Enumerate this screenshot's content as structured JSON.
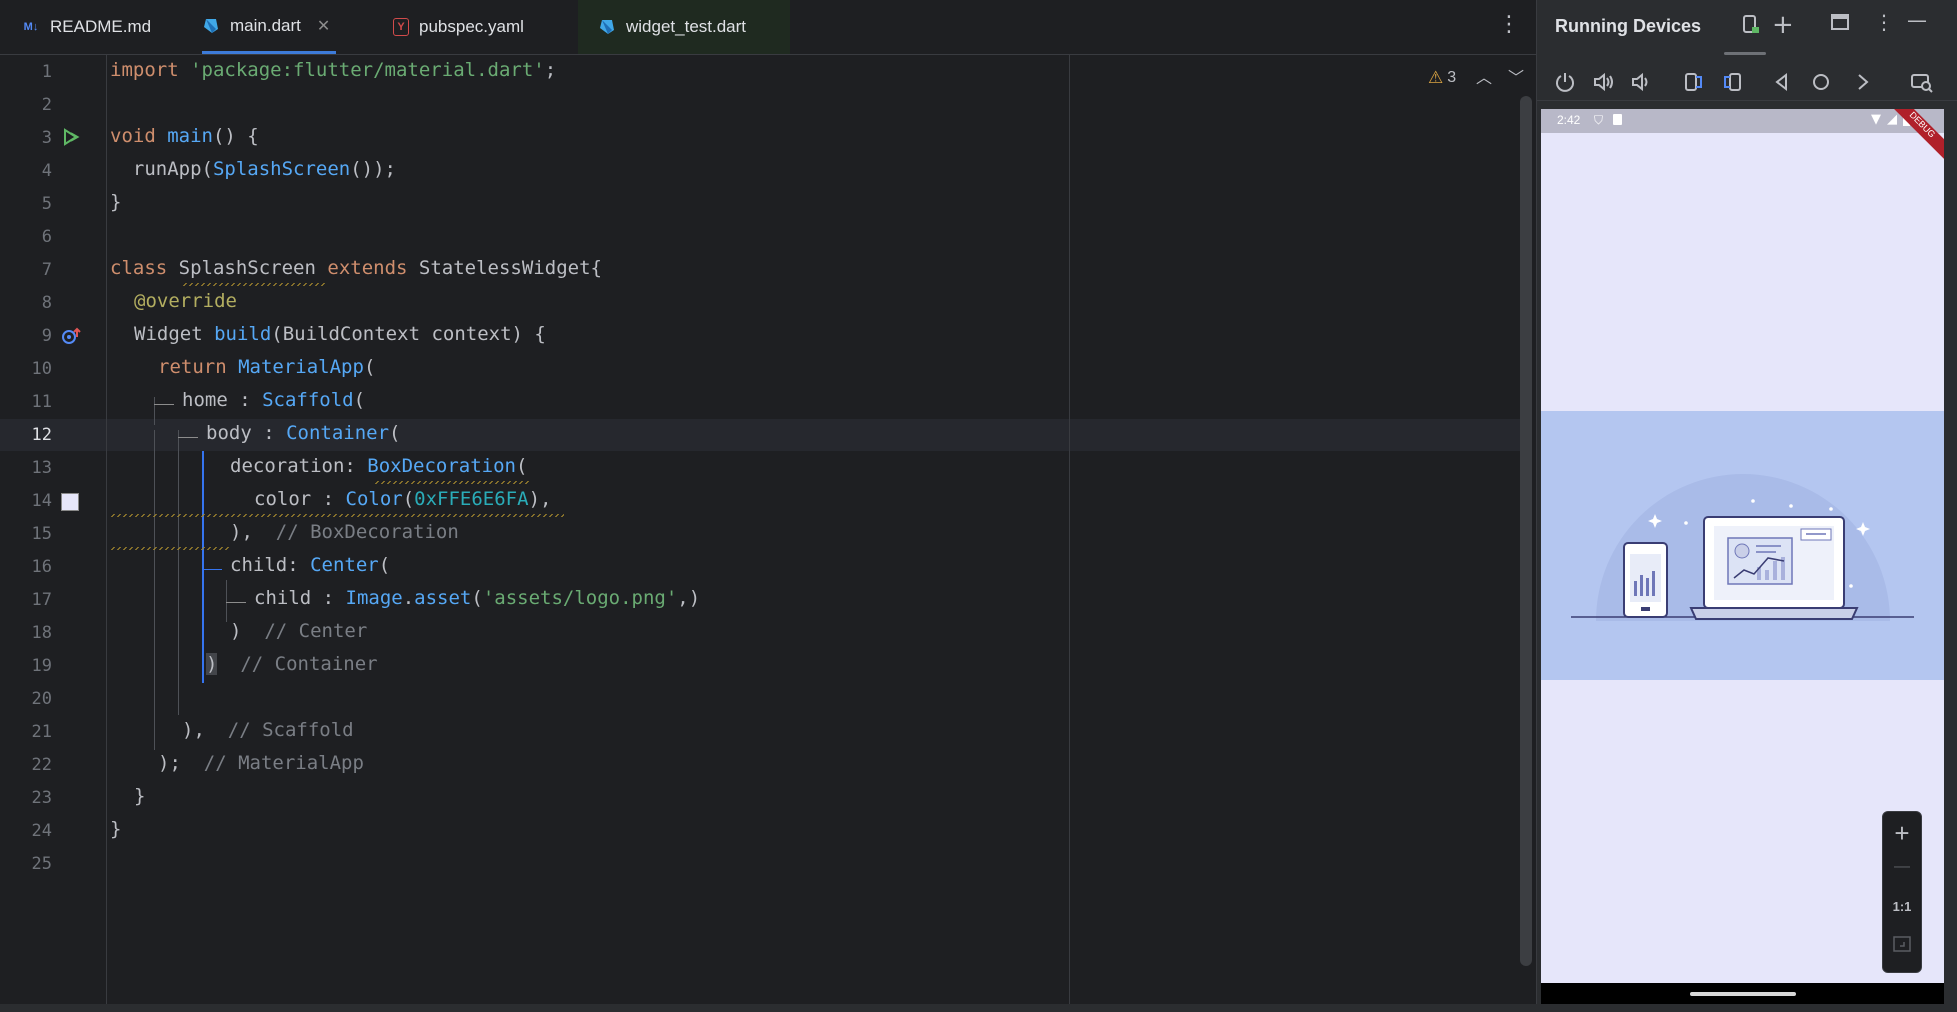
{
  "tabs": [
    {
      "label": "README.md",
      "icon": "markdown-icon",
      "active": false
    },
    {
      "label": "main.dart",
      "icon": "dart-icon",
      "active": true,
      "closable": true
    },
    {
      "label": "pubspec.yaml",
      "icon": "yaml-icon",
      "active": false
    },
    {
      "label": "widget_test.dart",
      "icon": "dart-icon",
      "active": false
    }
  ],
  "tab_close": "✕",
  "tab_icons": {
    "markdown": "M↓",
    "yaml": "Y"
  },
  "editor": {
    "current_line": 12,
    "warnings_count": "3",
    "line_numbers": [
      "1",
      "2",
      "3",
      "4",
      "5",
      "6",
      "7",
      "8",
      "9",
      "10",
      "11",
      "12",
      "13",
      "14",
      "15",
      "16",
      "17",
      "18",
      "19",
      "20",
      "21",
      "22",
      "23",
      "24",
      "25"
    ],
    "lines": {
      "l1_kw": "import",
      "l1_str": "'package:flutter/material.dart'",
      "l1_end": ";",
      "l3_kw": "void",
      "l3_fn": "main",
      "l3_end": "() {",
      "l4_a": "  runApp(",
      "l4_ty": "SplashScreen",
      "l4_end": "());",
      "l5": "}",
      "l7_kw": "class",
      "l7_name": "SplashScreen",
      "l7_kw2": "extends",
      "l7_end": "StatelessWidget{",
      "l8": "@override",
      "l9_a": "Widget",
      "l9_fn": "build",
      "l9_end": "(BuildContext context) {",
      "l10_kw": "return",
      "l10_ty": "MaterialApp",
      "l10_end": "(",
      "l11_a": "home : ",
      "l11_ty": "Scaffold",
      "l11_end": "(",
      "l12_a": "body : ",
      "l12_ty": "Container",
      "l12_end": "(",
      "l13_a": "decoration: ",
      "l13_ty": "BoxDecoration",
      "l13_end": "(",
      "l14_a": "color : ",
      "l14_ty": "Color",
      "l14_p": "(",
      "l14_num": "0xFFE6E6FA",
      "l14_end": "),",
      "l15_a": "),",
      "l15_cm": "// BoxDecoration",
      "l16_a": "child: ",
      "l16_ty": "Center",
      "l16_end": "(",
      "l17_a": "child : ",
      "l17_ty": "Image",
      "l17_dot": ".",
      "l17_fn": "asset",
      "l17_p": "(",
      "l17_str": "'assets/logo.png'",
      "l17_end": ",)",
      "l18_a": ")",
      "l18_cm": "// Center",
      "l19_a": ")",
      "l19_cm": "// Container",
      "l21_a": "),",
      "l21_cm": "// Scaffold",
      "l22_a": ");",
      "l22_cm": "// MaterialApp",
      "l23": "}",
      "l24": "}"
    },
    "color_swatch": "#E6E6FA"
  },
  "running_devices": {
    "title": "Running Devices",
    "toolbar_icons": [
      "power-icon",
      "volume-up-icon",
      "volume-down-icon",
      "rotate-left-icon",
      "rotate-right-icon",
      "back-icon",
      "home-icon",
      "overview-icon",
      "screenshot-icon"
    ],
    "phone": {
      "time": "2:42",
      "debug_label": "DEBUG",
      "background": "#E6E6FA",
      "band_color": "#B4C6F0"
    },
    "zoom": {
      "plus": "+",
      "minus": "—",
      "one_to_one": "1:1"
    }
  }
}
